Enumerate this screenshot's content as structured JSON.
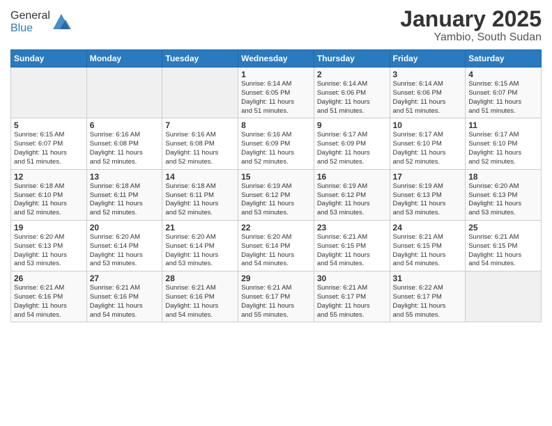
{
  "header": {
    "logo_general": "General",
    "logo_blue": "Blue",
    "title": "January 2025",
    "subtitle": "Yambio, South Sudan"
  },
  "weekdays": [
    "Sunday",
    "Monday",
    "Tuesday",
    "Wednesday",
    "Thursday",
    "Friday",
    "Saturday"
  ],
  "weeks": [
    [
      {
        "day": "",
        "info": ""
      },
      {
        "day": "",
        "info": ""
      },
      {
        "day": "",
        "info": ""
      },
      {
        "day": "1",
        "info": "Sunrise: 6:14 AM\nSunset: 6:05 PM\nDaylight: 11 hours\nand 51 minutes."
      },
      {
        "day": "2",
        "info": "Sunrise: 6:14 AM\nSunset: 6:06 PM\nDaylight: 11 hours\nand 51 minutes."
      },
      {
        "day": "3",
        "info": "Sunrise: 6:14 AM\nSunset: 6:06 PM\nDaylight: 11 hours\nand 51 minutes."
      },
      {
        "day": "4",
        "info": "Sunrise: 6:15 AM\nSunset: 6:07 PM\nDaylight: 11 hours\nand 51 minutes."
      }
    ],
    [
      {
        "day": "5",
        "info": "Sunrise: 6:15 AM\nSunset: 6:07 PM\nDaylight: 11 hours\nand 51 minutes."
      },
      {
        "day": "6",
        "info": "Sunrise: 6:16 AM\nSunset: 6:08 PM\nDaylight: 11 hours\nand 52 minutes."
      },
      {
        "day": "7",
        "info": "Sunrise: 6:16 AM\nSunset: 6:08 PM\nDaylight: 11 hours\nand 52 minutes."
      },
      {
        "day": "8",
        "info": "Sunrise: 6:16 AM\nSunset: 6:09 PM\nDaylight: 11 hours\nand 52 minutes."
      },
      {
        "day": "9",
        "info": "Sunrise: 6:17 AM\nSunset: 6:09 PM\nDaylight: 11 hours\nand 52 minutes."
      },
      {
        "day": "10",
        "info": "Sunrise: 6:17 AM\nSunset: 6:10 PM\nDaylight: 11 hours\nand 52 minutes."
      },
      {
        "day": "11",
        "info": "Sunrise: 6:17 AM\nSunset: 6:10 PM\nDaylight: 11 hours\nand 52 minutes."
      }
    ],
    [
      {
        "day": "12",
        "info": "Sunrise: 6:18 AM\nSunset: 6:10 PM\nDaylight: 11 hours\nand 52 minutes."
      },
      {
        "day": "13",
        "info": "Sunrise: 6:18 AM\nSunset: 6:11 PM\nDaylight: 11 hours\nand 52 minutes."
      },
      {
        "day": "14",
        "info": "Sunrise: 6:18 AM\nSunset: 6:11 PM\nDaylight: 11 hours\nand 52 minutes."
      },
      {
        "day": "15",
        "info": "Sunrise: 6:19 AM\nSunset: 6:12 PM\nDaylight: 11 hours\nand 53 minutes."
      },
      {
        "day": "16",
        "info": "Sunrise: 6:19 AM\nSunset: 6:12 PM\nDaylight: 11 hours\nand 53 minutes."
      },
      {
        "day": "17",
        "info": "Sunrise: 6:19 AM\nSunset: 6:13 PM\nDaylight: 11 hours\nand 53 minutes."
      },
      {
        "day": "18",
        "info": "Sunrise: 6:20 AM\nSunset: 6:13 PM\nDaylight: 11 hours\nand 53 minutes."
      }
    ],
    [
      {
        "day": "19",
        "info": "Sunrise: 6:20 AM\nSunset: 6:13 PM\nDaylight: 11 hours\nand 53 minutes."
      },
      {
        "day": "20",
        "info": "Sunrise: 6:20 AM\nSunset: 6:14 PM\nDaylight: 11 hours\nand 53 minutes."
      },
      {
        "day": "21",
        "info": "Sunrise: 6:20 AM\nSunset: 6:14 PM\nDaylight: 11 hours\nand 53 minutes."
      },
      {
        "day": "22",
        "info": "Sunrise: 6:20 AM\nSunset: 6:14 PM\nDaylight: 11 hours\nand 54 minutes."
      },
      {
        "day": "23",
        "info": "Sunrise: 6:21 AM\nSunset: 6:15 PM\nDaylight: 11 hours\nand 54 minutes."
      },
      {
        "day": "24",
        "info": "Sunrise: 6:21 AM\nSunset: 6:15 PM\nDaylight: 11 hours\nand 54 minutes."
      },
      {
        "day": "25",
        "info": "Sunrise: 6:21 AM\nSunset: 6:15 PM\nDaylight: 11 hours\nand 54 minutes."
      }
    ],
    [
      {
        "day": "26",
        "info": "Sunrise: 6:21 AM\nSunset: 6:16 PM\nDaylight: 11 hours\nand 54 minutes."
      },
      {
        "day": "27",
        "info": "Sunrise: 6:21 AM\nSunset: 6:16 PM\nDaylight: 11 hours\nand 54 minutes."
      },
      {
        "day": "28",
        "info": "Sunrise: 6:21 AM\nSunset: 6:16 PM\nDaylight: 11 hours\nand 54 minutes."
      },
      {
        "day": "29",
        "info": "Sunrise: 6:21 AM\nSunset: 6:17 PM\nDaylight: 11 hours\nand 55 minutes."
      },
      {
        "day": "30",
        "info": "Sunrise: 6:21 AM\nSunset: 6:17 PM\nDaylight: 11 hours\nand 55 minutes."
      },
      {
        "day": "31",
        "info": "Sunrise: 6:22 AM\nSunset: 6:17 PM\nDaylight: 11 hours\nand 55 minutes."
      },
      {
        "day": "",
        "info": ""
      }
    ]
  ]
}
